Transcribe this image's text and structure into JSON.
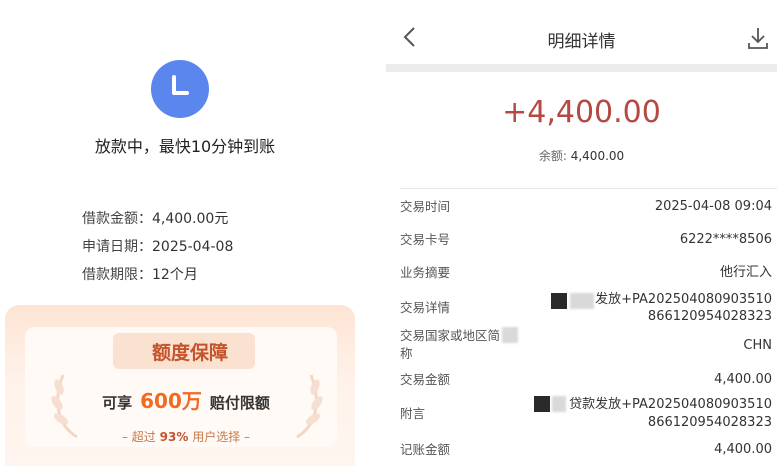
{
  "left": {
    "status": "放款中，最快10分钟到账",
    "info": [
      {
        "label": "借款金额：",
        "value": "4,400.00元"
      },
      {
        "label": "申请日期：",
        "value": "2025-04-08"
      },
      {
        "label": "借款期限：",
        "value": "12个月"
      }
    ],
    "guarantee": {
      "title": "额度保障",
      "prefix": "可享",
      "amount": "600万",
      "suffix": "赔付限额",
      "sub_prefix": "– 超过",
      "sub_pct": "93%",
      "sub_suffix": "用户选择 –"
    }
  },
  "right": {
    "nav_title": "明细详情",
    "amount": "+4,400.00",
    "balance_label": "余额:",
    "balance_value": "4,400.00",
    "rows": [
      {
        "label": "交易时间",
        "value": "2025-04-08 09:04"
      },
      {
        "label": "交易卡号",
        "value": "6222****8506"
      },
      {
        "label": "业务摘要",
        "value": "他行汇入"
      },
      {
        "label": "交易详情",
        "value_1": "发放+PA202504080903510",
        "value_2": "866120954028323"
      },
      {
        "label_1": "交易国家或地区简",
        "label_2": "称",
        "value": "CHN"
      },
      {
        "label": "交易金额",
        "value": "4,400.00"
      },
      {
        "label": "附言",
        "value_1": "贷款发放+PA202504080903510",
        "value_2": "866120954028323"
      },
      {
        "label": "记账金额",
        "value": "4,400.00"
      }
    ]
  },
  "colors": {
    "clock_bg": "#5b86ee",
    "amount_red": "#b54842",
    "guarantee_orange": "#f06a22",
    "guarantee_title": "#c4542c"
  },
  "icons": [
    "clock-icon",
    "back-arrow-icon",
    "download-icon",
    "laurel-left-icon",
    "laurel-right-icon"
  ]
}
